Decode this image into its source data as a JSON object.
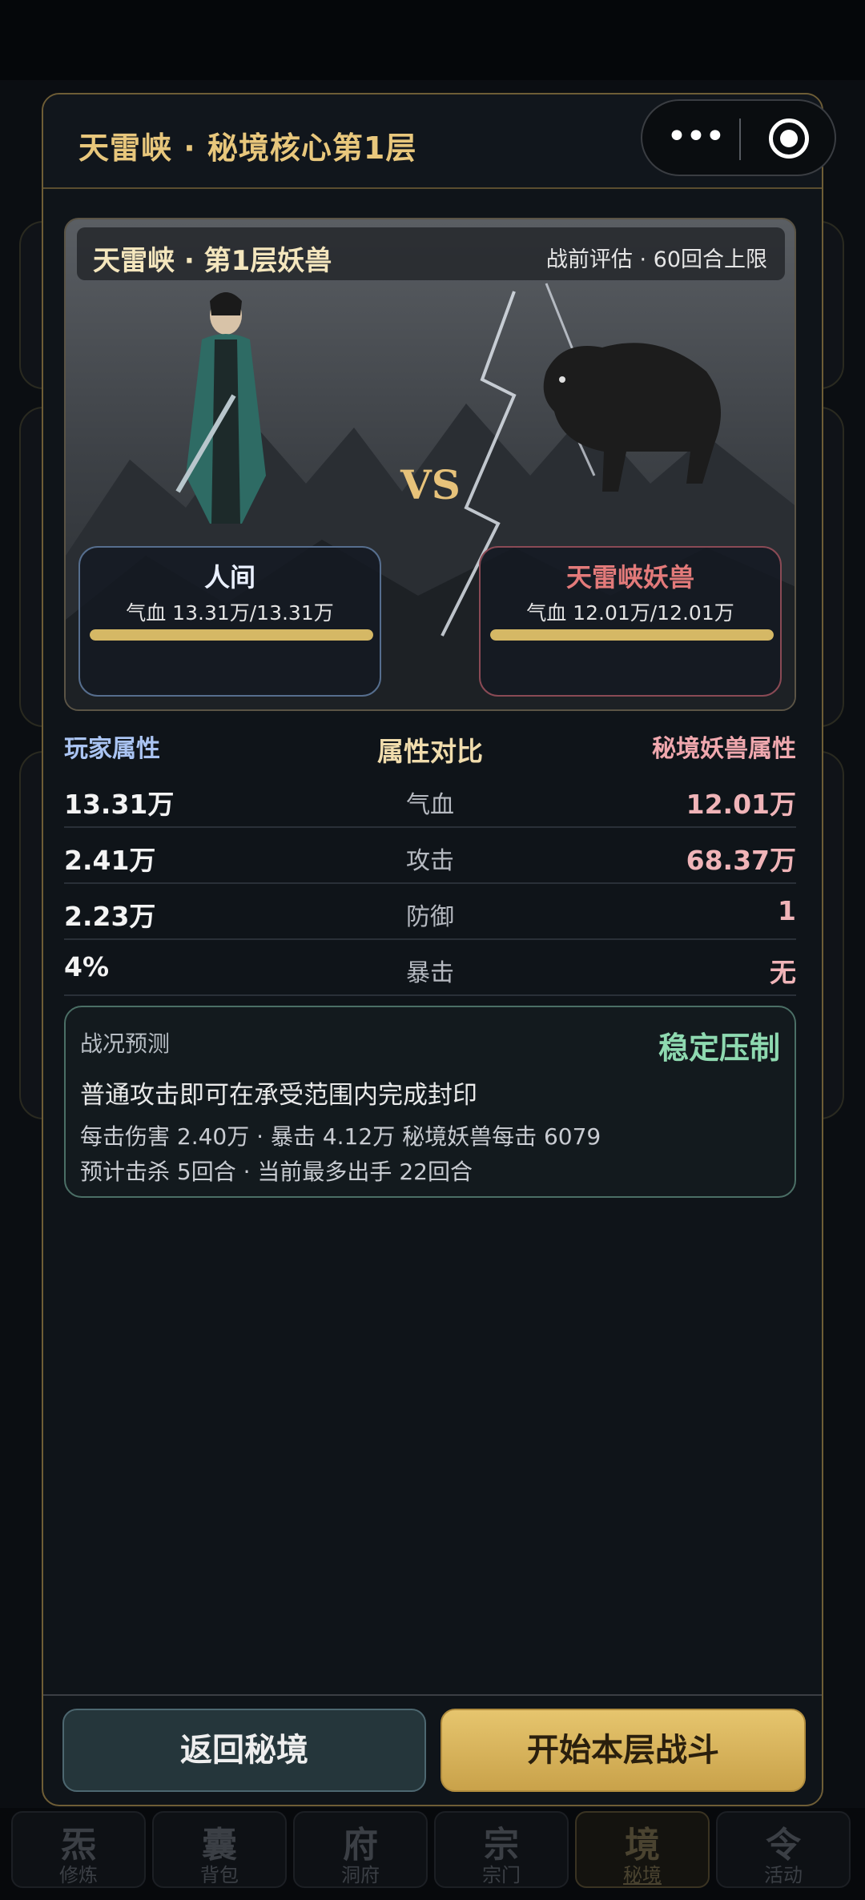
{
  "modal": {
    "title": "天雷峡 · 秘境核心第1层"
  },
  "capsule": {
    "more_icon": "more-dots-icon",
    "close_icon": "target-circle-icon"
  },
  "scene": {
    "title": "天雷峡 · 第1层妖兽",
    "info": "战前评估 · 60回合上限",
    "vs": "VS",
    "player": {
      "name": "人间",
      "hp_text": "气血 13.31万/13.31万",
      "hp_fraction": 1.0
    },
    "enemy": {
      "name": "天雷峡妖兽",
      "hp_text": "气血 12.01万/12.01万",
      "hp_fraction": 1.0
    }
  },
  "stats": {
    "left_header": "玩家属性",
    "mid_header": "属性对比",
    "right_header": "秘境妖兽属性",
    "rows": [
      {
        "player": "13.31万",
        "label": "气血",
        "enemy": "12.01万"
      },
      {
        "player": "2.41万",
        "label": "攻击",
        "enemy": "68.37万"
      },
      {
        "player": "2.23万",
        "label": "防御",
        "enemy": "1"
      },
      {
        "player": "4%",
        "label": "暴击",
        "enemy": "无"
      }
    ]
  },
  "prediction": {
    "label": "战况预测",
    "result": "稳定压制",
    "desc": "普通攻击即可在承受范围内完成封印",
    "line1": "每击伤害 2.40万 · 暴击 4.12万   秘境妖兽每击 6079",
    "line2": "预计击杀 5回合 · 当前最多出手 22回合"
  },
  "buttons": {
    "back": "返回秘境",
    "start": "开始本层战斗"
  },
  "nav": [
    {
      "glyph": "炁",
      "label": "修炼"
    },
    {
      "glyph": "囊",
      "label": "背包"
    },
    {
      "glyph": "府",
      "label": "洞府"
    },
    {
      "glyph": "宗",
      "label": "宗门"
    },
    {
      "glyph": "境",
      "label": "秘境",
      "active": true
    },
    {
      "glyph": "令",
      "label": "活动"
    }
  ],
  "colors": {
    "gold": "#e8c77c",
    "panel": "#0f1419",
    "good": "#8ed9b0",
    "enemy": "#e37a7a"
  }
}
